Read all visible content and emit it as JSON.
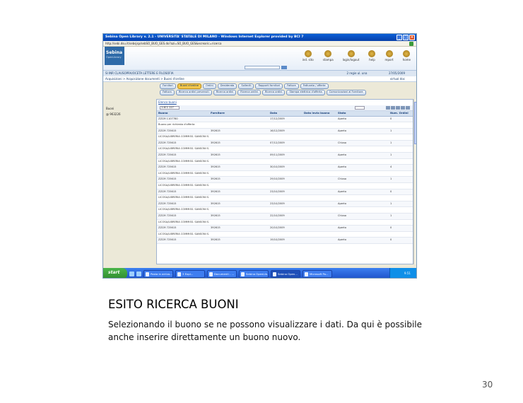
{
  "window": {
    "title": "Sebina Open Library v. 2.1 - UNIVERSITA' STATALE DI MILANO - Windows Internet Explorer provided by BCI 7",
    "controls": [
      "_",
      "□",
      "×"
    ],
    "address": "http://sebi.dsu.it/sebsjsp/sebSO_BUO_GES.do?azi=SO_BUO_GES&ecrearic=ricerca"
  },
  "app": {
    "logo": "Sebina",
    "logo_sub": "OpenLibrary",
    "top_icons": [
      "ind. sito",
      "stampa",
      "login/logout",
      "help",
      "report",
      "home"
    ],
    "info_left": "SI INR CLAUSOPRA/OCETA LETTERE E FILOSOFIA",
    "info_right": "2 regie ul. una",
    "info_date": "27/05/2009",
    "breadcrumb": "Acquisizioni > Acquisizione documenti > Buoni d'ordine",
    "breadcrumb_right": "virtual doc"
  },
  "tabs_row1": [
    "Fornitori",
    "Buoni d'ordine",
    "Ordini",
    "Desiderata",
    "Solleciti",
    "Rapporti fornitori",
    "Fatture",
    "Fatturato / offerte"
  ],
  "tabs_row1_active": 1,
  "tabs_row2": [
    "Fattura",
    "Ricerca ordini pervenuti",
    "Ricerca ordini",
    "Ricerca ordini",
    "Ricerca ordini",
    "Stampa elettrica d'offerta",
    "Comunicazioni al Fornitore"
  ],
  "sidebar": {
    "label": "Buoni",
    "value": "@  963226"
  },
  "panel": {
    "title": "Elenco buoni",
    "select": "1 di 1 117"
  },
  "grid": {
    "headers": [
      "Buono",
      "Fornitore",
      "Data",
      "Data invio buono",
      "Stato",
      "Num. Ordini"
    ],
    "rows": [
      [
        "ZZCM 1107780",
        "",
        "17/12/2009",
        "",
        "Aperto",
        "0"
      ],
      [
        "Buono per richiesta d'offerta",
        "",
        "",
        "",
        "",
        ""
      ],
      [
        "ZZCM 725615",
        "392615",
        "16/12/2009",
        "",
        "Aperto",
        "1"
      ],
      [
        "LICOSA/LIBRERIA COMMISS. SANSONI S.P.A.",
        "",
        "",
        "",
        "",
        ""
      ],
      [
        "ZZCM 725615",
        "392615",
        "07/12/2009",
        "",
        "Chiuso",
        "1"
      ],
      [
        "LICOSA/LIBRERIA COMMISS. SANSONI S.P.A.",
        "",
        "",
        "",
        "",
        ""
      ],
      [
        "ZZCM 725615",
        "392615",
        "09/11/2009",
        "",
        "Aperto",
        "1"
      ],
      [
        "LICOSA/LIBRERIA COMMISS. SANSONI S.P.A.",
        "",
        "",
        "",
        "",
        ""
      ],
      [
        "ZZCM 725615",
        "392615",
        "30/10/2009",
        "",
        "Aperto",
        "4"
      ],
      [
        "LICOSA/LIBRERIA COMMISS. SANSONI S.P.A.",
        "",
        "",
        "",
        "",
        ""
      ],
      [
        "ZZCM 725615",
        "392615",
        "29/10/2009",
        "",
        "Chiuso",
        "1"
      ],
      [
        "LICOSA/LIBRERIA COMMISS. SANSONI S.P.A.",
        "",
        "",
        "",
        "",
        ""
      ],
      [
        "ZZCM 725615",
        "392615",
        "23/10/2009",
        "",
        "Aperto",
        "0"
      ],
      [
        "LICOSA/LIBRERIA COMMISS. SANSONI S.P.A.",
        "",
        "",
        "",
        "",
        ""
      ],
      [
        "ZZCM 725615",
        "392615",
        "23/10/2009",
        "",
        "Aperto",
        "1"
      ],
      [
        "LICOSA/LIBRERIA COMMISS. SANSONI S.P.A.",
        "",
        "",
        "",
        "",
        ""
      ],
      [
        "ZZCM 725615",
        "392615",
        "22/10/2009",
        "",
        "Chiuso",
        "1"
      ],
      [
        "LICOSA/LIBRERIA COMMISS. SANSONI S.P.A.",
        "",
        "",
        "",
        "",
        ""
      ],
      [
        "ZZCM 725615",
        "392615",
        "20/10/2009",
        "",
        "Aperto",
        "0"
      ],
      [
        "LICOSA/LIBRERIA COMMISS. SANSONI S.P.A.",
        "",
        "",
        "",
        "",
        ""
      ],
      [
        "ZZCM 725615",
        "392615",
        "19/10/2009",
        "",
        "Aperto",
        "0"
      ]
    ]
  },
  "taskbar": {
    "start": "start",
    "tasks": [
      "Posta in arrivo...",
      "3 Expl...",
      "Documenti - ...",
      "Sebina OpenLib...",
      "Sebina Open...",
      "Microsoft Po..."
    ],
    "active_task": 4,
    "clock": "9.51"
  },
  "slide": {
    "title": "ESITO RICERCA BUONI",
    "body_line1": "Selezionando il buono se ne possono visualizzare i dati. Da qui è possibile",
    "body_line2": "anche inserire direttamente un buono nuovo.",
    "page_number": "30"
  }
}
